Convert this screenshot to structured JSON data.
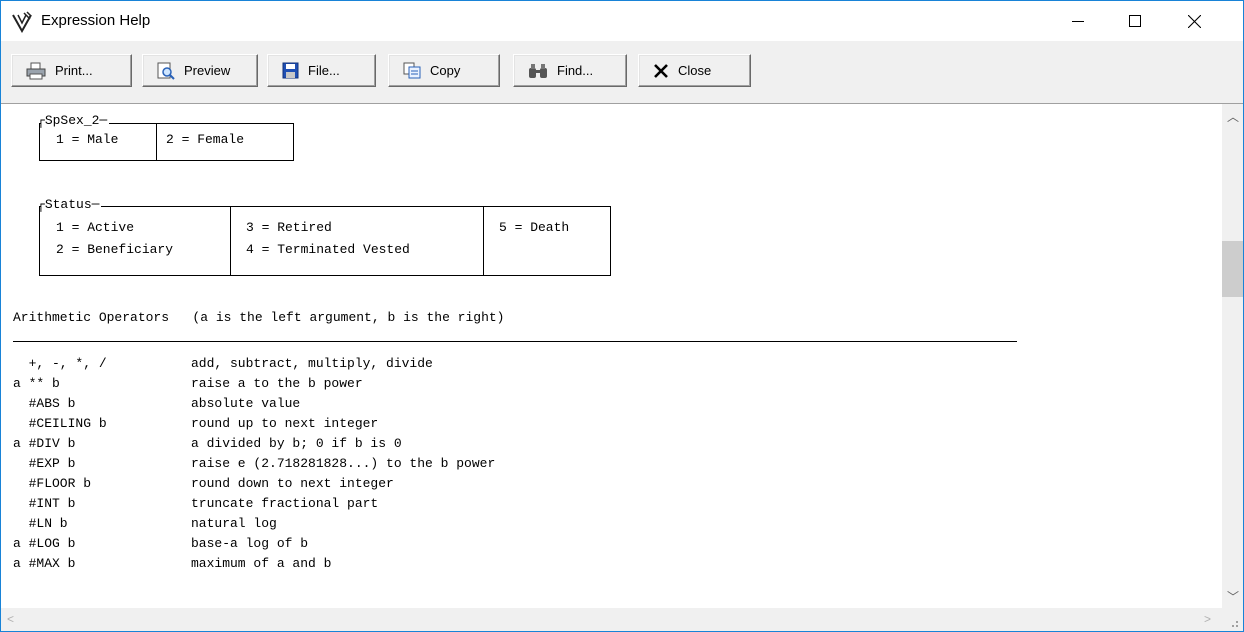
{
  "window": {
    "title": "Expression Help",
    "app_icon": "expression-app-icon"
  },
  "toolbar": {
    "print": {
      "label": "Print...",
      "icon": "printer-icon"
    },
    "preview": {
      "label": "Preview",
      "icon": "preview-icon"
    },
    "file": {
      "label": "File...",
      "icon": "floppy-disk-icon"
    },
    "copy": {
      "label": "Copy",
      "icon": "copy-icon"
    },
    "find": {
      "label": "Find...",
      "icon": "binoculars-icon"
    },
    "close": {
      "label": "Close",
      "icon": "close-x-icon"
    }
  },
  "spsex": {
    "title": "SpSex_2",
    "cells": [
      "1 = Male",
      "2 = Female"
    ]
  },
  "status": {
    "title": "Status",
    "col1": [
      "1 = Active",
      "2 = Beneficiary"
    ],
    "col2": [
      "3 = Retired",
      "4 = Terminated Vested"
    ],
    "col3": [
      "5 = Death"
    ]
  },
  "arithmetic": {
    "title": "Arithmetic Operators   (a is the left argument, b is the right)",
    "operators": [
      {
        "name": "  +, -, *, /",
        "desc": "add, subtract, multiply, divide"
      },
      {
        "name": "a ** b",
        "desc": "raise a to the b power"
      },
      {
        "name": "  #ABS b",
        "desc": "absolute value"
      },
      {
        "name": "  #CEILING b",
        "desc": "round up to next integer"
      },
      {
        "name": "a #DIV b",
        "desc": "a divided by b; 0 if b is 0"
      },
      {
        "name": "  #EXP b",
        "desc": "raise e (2.718281828...) to the b power"
      },
      {
        "name": "  #FLOOR b",
        "desc": "round down to next integer"
      },
      {
        "name": "  #INT b",
        "desc": "truncate fractional part"
      },
      {
        "name": "  #LN b",
        "desc": "natural log"
      },
      {
        "name": "a #LOG b",
        "desc": "base-a log of b"
      },
      {
        "name": "a #MAX b",
        "desc": "maximum of a and b"
      }
    ]
  }
}
